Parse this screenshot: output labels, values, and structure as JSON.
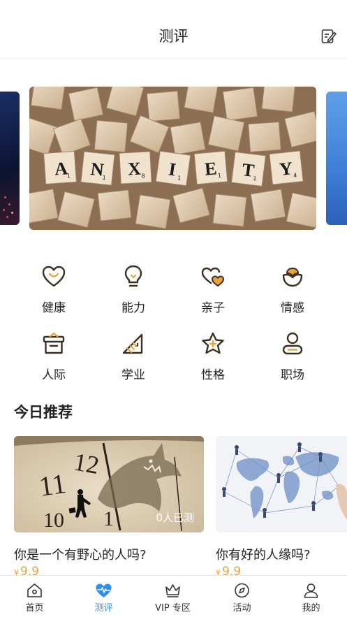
{
  "header": {
    "title": "测评",
    "edit_icon": "edit-icon"
  },
  "banner": {
    "main_letters": [
      "A",
      "N",
      "X",
      "I",
      "E",
      "T",
      "Y"
    ],
    "main_subscripts": [
      "1",
      "1",
      "8",
      "1",
      "1",
      "1",
      "4"
    ]
  },
  "categories": [
    {
      "label": "健康",
      "icon": "heart-icon"
    },
    {
      "label": "能力",
      "icon": "lightbulb-icon"
    },
    {
      "label": "亲子",
      "icon": "two-hearts-icon"
    },
    {
      "label": "情感",
      "icon": "flower-icon"
    },
    {
      "label": "人际",
      "icon": "gift-box-icon"
    },
    {
      "label": "学业",
      "icon": "ruler-icon"
    },
    {
      "label": "性格",
      "icon": "star-plus-icon"
    },
    {
      "label": "职场",
      "icon": "person-icon"
    }
  ],
  "recommend": {
    "title": "今日推荐",
    "cards": [
      {
        "title": "你是一个有野心的人吗?",
        "count": "0人已测",
        "price_symbol": "¥",
        "price": "9.9"
      },
      {
        "title": "你有好的人缘吗?",
        "price_symbol": "¥",
        "price": "9.9"
      }
    ]
  },
  "tabbar": {
    "items": [
      {
        "label": "首页",
        "icon": "home-icon"
      },
      {
        "label": "测评",
        "icon": "heartbeat-icon"
      },
      {
        "label": "VIP 专区",
        "icon": "crown-icon"
      },
      {
        "label": "活动",
        "icon": "compass-icon"
      },
      {
        "label": "我的",
        "icon": "user-icon"
      }
    ],
    "active_index": 1
  },
  "colors": {
    "accent": "#e8a33a",
    "active_tab": "#2f8ff0",
    "icon_stroke": "#3a3020"
  }
}
